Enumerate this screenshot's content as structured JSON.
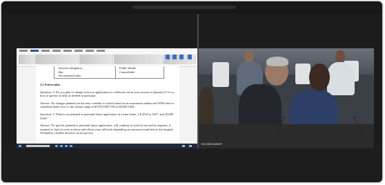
{
  "window": {
    "title": ""
  },
  "document": {
    "table_fragment": {
      "col1_line1": "between mitigation",
      "col1_line2": "Rm",
      "col1_line3": "Documented tasks",
      "col2_line1": "Public details",
      "col2_line2": "Controllable"
    },
    "section_heading": "2.2 Future plan",
    "paragraphs": [
      "Question: 2: Do you plan to change from our application to a different one in your session in Question 2? If so, how to specify as fully as needed in particular.",
      "Answer: No changes planned yet but may consider to switch based on an assessment studies and WHO data to contribute better tool; to the current range of ¥5,075,000 VTD at 80,000 USD.",
      "Question: 3: What is our planned or potential future application in a time frame, 2 ¥ 2023 to 2027, and 20,000 USD?",
      "Answer: No specific planned or potential future application. will continue to track its use and in response, if required to find its work as future and efforts from all levels depending on outcomes made before the hospital. Ultimately a further decision on the process."
    ]
  },
  "video": {
    "overlay_label": "ECOSOC/UNDP"
  }
}
